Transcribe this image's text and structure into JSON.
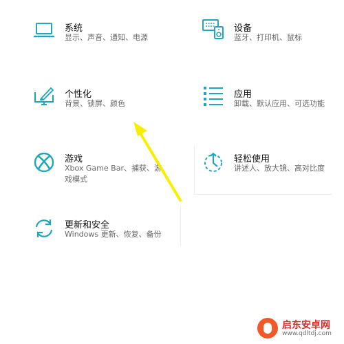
{
  "settings": {
    "tiles": [
      {
        "id": "system",
        "title": "系统",
        "desc": "显示、声音、通知、电源",
        "icon": "laptop-icon"
      },
      {
        "id": "devices",
        "title": "设备",
        "desc": "蓝牙、打印机、鼠标",
        "icon": "devices-icon"
      },
      {
        "id": "personalization",
        "title": "个性化",
        "desc": "背景、锁屏、颜色",
        "icon": "personalization-icon"
      },
      {
        "id": "apps",
        "title": "应用",
        "desc": "卸载、默认应用、可选功能",
        "icon": "apps-icon"
      },
      {
        "id": "gaming",
        "title": "游戏",
        "desc": "Xbox Game Bar、捕获、游戏模式",
        "icon": "xbox-icon"
      },
      {
        "id": "ease-of-access",
        "title": "轻松使用",
        "desc": "讲述人、放大镜、高对比度",
        "icon": "ease-of-access-icon"
      },
      {
        "id": "update-security",
        "title": "更新和安全",
        "desc": "Windows 更新、恢复、备份",
        "icon": "update-icon"
      }
    ]
  },
  "accent": "#1fa6bd",
  "annotation_arrow_color": "#f6f000",
  "watermark": {
    "title": "启东安卓网",
    "url": "www.qdltdj.com"
  }
}
